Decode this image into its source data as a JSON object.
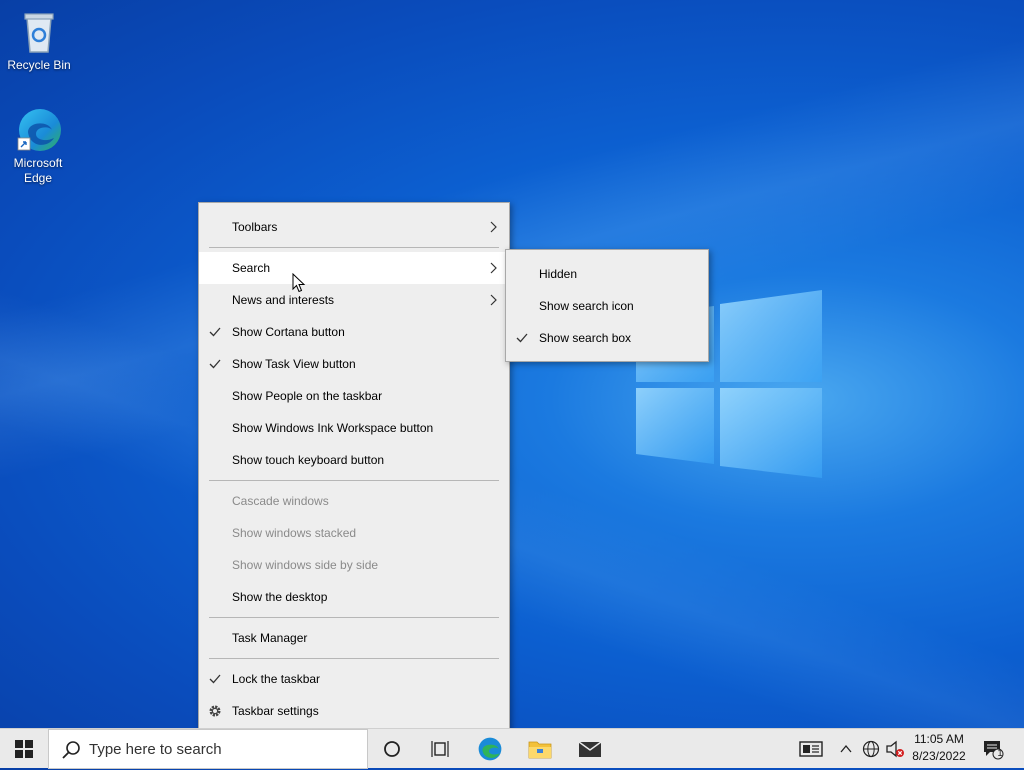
{
  "desktop": {
    "icons": [
      {
        "label": "Recycle Bin"
      },
      {
        "label": "Microsoft Edge"
      }
    ]
  },
  "context_menu": {
    "items": [
      {
        "label": "Toolbars",
        "submenu": true
      },
      {
        "label": "Search",
        "submenu": true,
        "highlighted": true
      },
      {
        "label": "News and interests",
        "submenu": true
      },
      {
        "label": "Show Cortana button",
        "checked": true
      },
      {
        "label": "Show Task View button",
        "checked": true
      },
      {
        "label": "Show People on the taskbar"
      },
      {
        "label": "Show Windows Ink Workspace button"
      },
      {
        "label": "Show touch keyboard button"
      },
      {
        "label": "Cascade windows",
        "disabled": true
      },
      {
        "label": "Show windows stacked",
        "disabled": true
      },
      {
        "label": "Show windows side by side",
        "disabled": true
      },
      {
        "label": "Show the desktop"
      },
      {
        "label": "Task Manager"
      },
      {
        "label": "Lock the taskbar",
        "checked": true
      },
      {
        "label": "Taskbar settings",
        "icon": "gear-icon"
      }
    ]
  },
  "search_submenu": {
    "items": [
      {
        "label": "Hidden"
      },
      {
        "label": "Show search icon"
      },
      {
        "label": "Show search box",
        "checked": true
      }
    ]
  },
  "taskbar": {
    "search_placeholder": "Type here to search",
    "clock_time": "11:05 AM",
    "clock_date": "8/23/2022",
    "notification_count": "1",
    "icons": [
      "windows-start-icon",
      "cortana-icon",
      "task-view-icon",
      "edge-icon",
      "file-explorer-icon",
      "mail-icon",
      "news-icon",
      "chevron-up-icon",
      "network-icon",
      "volume-muted-icon",
      "action-center-icon"
    ]
  },
  "colors": {
    "desktop_blue": "#0c5fd0",
    "menu_bg": "#eeeeee",
    "menu_disabled_text": "#8a8a8a",
    "taskbar_bg": "#eaeaea"
  }
}
